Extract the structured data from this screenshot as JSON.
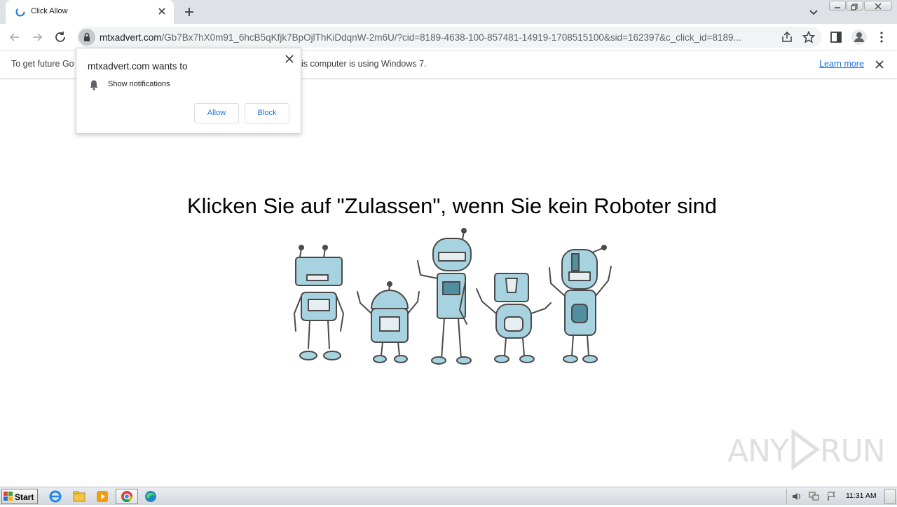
{
  "browser": {
    "tab_title": "Click Allow",
    "url_host": "mtxadvert.com",
    "url_path": "/Gb7Bx7hX0m91_6hcB5qKfjk7BpOjlThKiDdqnW-2m6U/?cid=8189-4638-100-857481-14919-1708515100&sid=162397&c_click_id=8189..."
  },
  "infobar": {
    "text_left": "To get future Go",
    "text_right": "is computer is using Windows 7.",
    "learn_more": "Learn more"
  },
  "permission_popup": {
    "title": "mtxadvert.com wants to",
    "item": "Show notifications",
    "allow_label": "Allow",
    "block_label": "Block"
  },
  "page": {
    "headline": "Klicken Sie auf \"Zulassen\", wenn Sie kein Roboter sind"
  },
  "watermark": {
    "left": "ANY",
    "right": "RUN"
  },
  "taskbar": {
    "start_label": "Start",
    "clock": "11:31 AM"
  },
  "colors": {
    "accent": "#1a73e8",
    "robot_body": "#a7d3e0",
    "robot_outline": "#4a4a4a"
  }
}
